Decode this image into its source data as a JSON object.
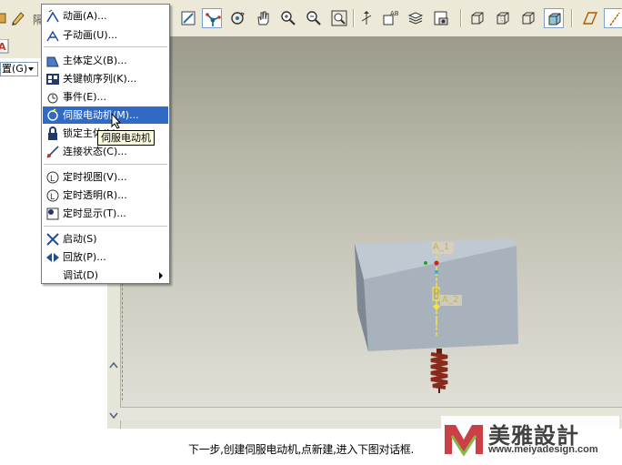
{
  "toolbar": {
    "left_fragment_label": "隔",
    "buttons": [
      {
        "name": "snapshot-icon"
      },
      {
        "name": "joint-axis-icon"
      },
      {
        "name": "spin-icon"
      },
      {
        "name": "pan-hand-icon"
      },
      {
        "name": "zoom-in-icon"
      },
      {
        "name": "zoom-out-icon"
      },
      {
        "name": "zoom-window-icon"
      },
      {
        "name": "orient-icon"
      },
      {
        "name": "view-manager-icon"
      },
      {
        "name": "layers-icon"
      },
      {
        "name": "saved-view-icon"
      },
      {
        "name": "wireframe-icon"
      },
      {
        "name": "hidden-line-icon"
      },
      {
        "name": "no-hidden-icon"
      },
      {
        "name": "shading-icon"
      },
      {
        "name": "datum-plane-icon"
      },
      {
        "name": "datum-axis-icon"
      }
    ]
  },
  "left_panel": {
    "dropdown_value": "置(G)"
  },
  "menu": {
    "items": [
      {
        "label": "动画(A)...",
        "icon": "animation-icon"
      },
      {
        "label": "子动画(U)...",
        "icon": "sub-animation-icon"
      },
      {
        "label": "主体定义(B)...",
        "icon": "body-definition-icon"
      },
      {
        "label": "关键帧序列(K)...",
        "icon": "keyframe-sequence-icon"
      },
      {
        "label": "事件(E)...",
        "icon": "event-icon"
      },
      {
        "label": "伺服电动机(M)...",
        "icon": "servo-motor-icon"
      },
      {
        "label": "锁定主体(L)...",
        "icon": "lock-body-icon"
      },
      {
        "label": "连接状态(C)...",
        "icon": "connection-status-icon"
      },
      {
        "label": "定时视图(V)...",
        "icon": "timed-view-icon"
      },
      {
        "label": "定时透明(R)...",
        "icon": "timed-transparency-icon"
      },
      {
        "label": "定时显示(T)...",
        "icon": "timed-display-icon"
      },
      {
        "label": "启动(S)",
        "icon": "start-icon"
      },
      {
        "label": "回放(P)...",
        "icon": "playback-icon"
      },
      {
        "label": "调试(D)",
        "icon": ""
      }
    ]
  },
  "tooltip": "伺服电动机",
  "model": {
    "label_a1": "A_1",
    "label_a2": "A_2",
    "label_d": "D"
  },
  "caption": "下一步,创建伺服电动机,点新建,进入下图对话框.",
  "watermark": {
    "name": "美雅設計",
    "url": "www.meiyadesign.com"
  },
  "colors": {
    "menu_highlight": "#316ac5",
    "block_face": "#a7b2bc",
    "spring": "#8a2a1c",
    "datum_yellow": "#f4e23c",
    "tooltip_bg": "#ffffe1"
  }
}
